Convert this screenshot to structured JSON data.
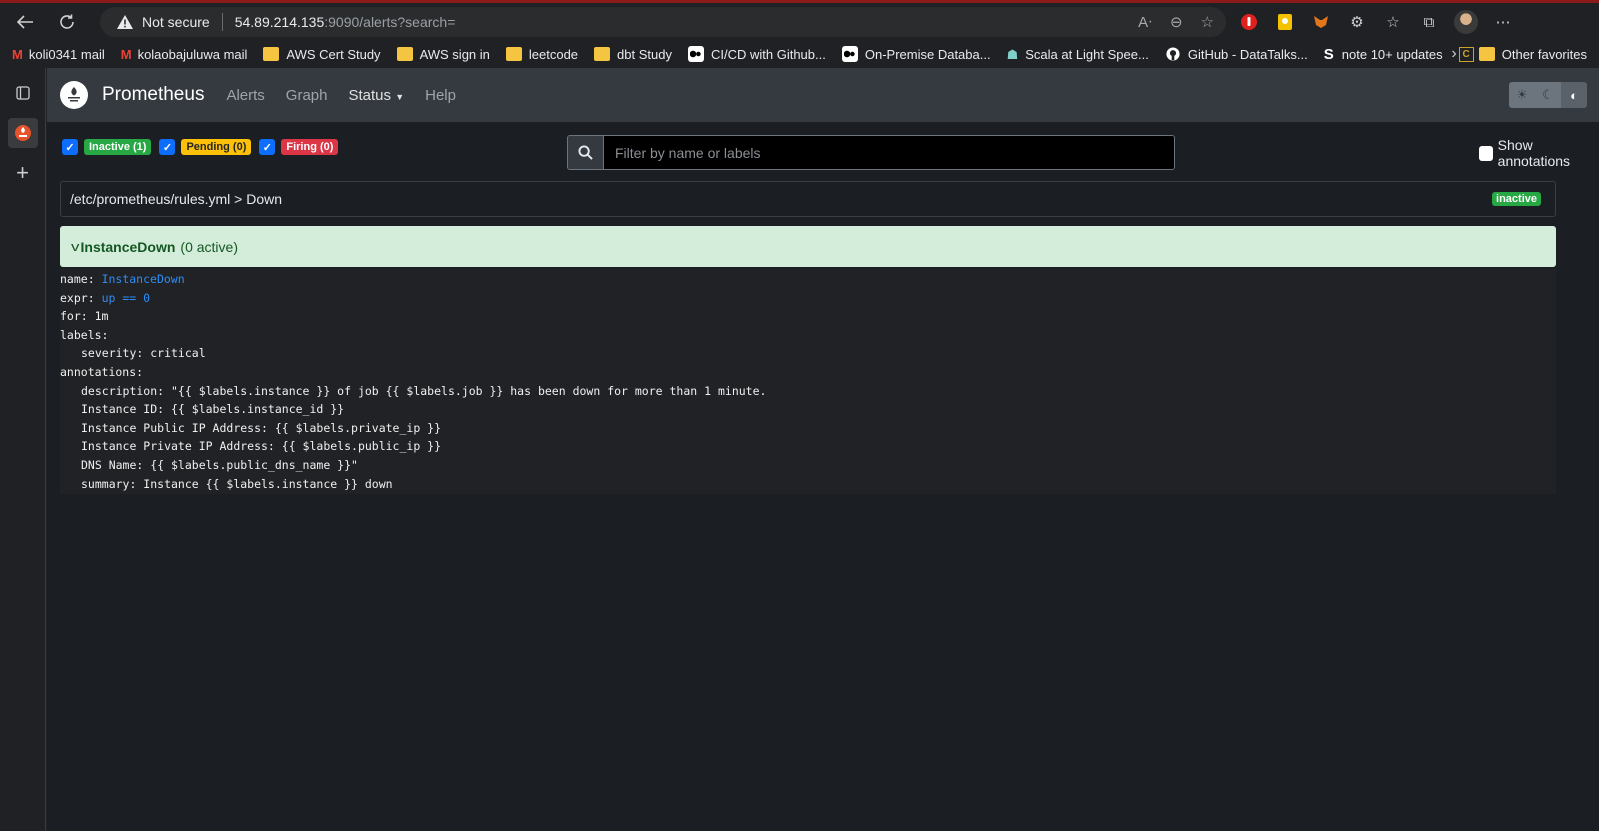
{
  "browser": {
    "not_secure": "Not secure",
    "url_host": "54.89.214.135",
    "url_rest": ":9090/alerts?search="
  },
  "bookmarks": [
    {
      "label": "koli0341 mail",
      "icon": "gmail-icon"
    },
    {
      "label": "kolaobajuluwa mail",
      "icon": "gmail-icon"
    },
    {
      "label": "AWS Cert Study",
      "icon": "folder-icon"
    },
    {
      "label": "AWS sign in",
      "icon": "folder-icon"
    },
    {
      "label": "leetcode",
      "icon": "folder-icon"
    },
    {
      "label": "dbt Study",
      "icon": "folder-icon"
    },
    {
      "label": "CI/CD with Github...",
      "icon": "medium-icon"
    },
    {
      "label": "On-Premise Databa...",
      "icon": "medium-icon"
    },
    {
      "label": "Scala at Light Spee...",
      "icon": "scala-icon"
    },
    {
      "label": "GitHub - DataTalks...",
      "icon": "github-icon"
    },
    {
      "label": "note 10+ updates",
      "icon": "s-icon"
    }
  ],
  "other_favorites": "Other favorites",
  "app": {
    "brand": "Prometheus",
    "nav": {
      "alerts": "Alerts",
      "graph": "Graph",
      "status": "Status",
      "help": "Help"
    },
    "filters": {
      "inactive": "Inactive (1)",
      "pending": "Pending (0)",
      "firing": "Firing (0)"
    },
    "search_placeholder": "Filter by name or labels",
    "show_annotations": "Show annotations",
    "group": {
      "path": "/etc/prometheus/rules.yml > Down",
      "state": "inactive"
    },
    "rule": {
      "name": "InstanceDown",
      "active": "(0 active)"
    },
    "definition": {
      "name_key": "name:",
      "name_val": "InstanceDown",
      "expr_key": "expr:",
      "expr_val": "up == 0",
      "for_line": "for: 1m",
      "labels_key": "labels:",
      "severity_line": "severity: critical",
      "annotations_key": "annotations:",
      "description_line": "description: \"{{ $labels.instance }} of job {{ $labels.job }} has been down for more than 1 minute.",
      "instance_id_line": "Instance ID: {{ $labels.instance_id }}",
      "public_ip_line": "Instance Public IP Address: {{ $labels.private_ip }}",
      "private_ip_line": "Instance Private IP Address: {{ $labels.public_ip }}",
      "dns_line": "DNS Name: {{ $labels.public_dns_name }}\"",
      "summary_line": "summary: Instance {{ $labels.instance }} down"
    }
  }
}
